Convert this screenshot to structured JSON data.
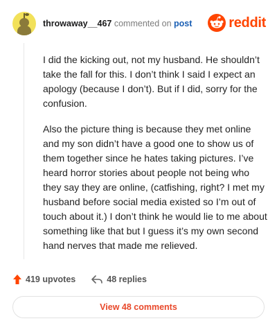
{
  "header": {
    "username": "throwaway__467",
    "action": "commented on",
    "link": "post",
    "brand": "reddit"
  },
  "comment": {
    "paragraphs": [
      "I did the kicking out, not my husband. He shouldn’t take the fall for this. I don’t think I said I expect an apology (because I don’t). But if I did, sorry for the confusion.",
      "Also the picture thing is because they met online and my son didn’t have a good one to show us of them together since he hates taking pictures. I’ve heard horror stories about people not being who they say they are online, (catfishing, right? I met my husband before social media existed so I’m out of touch about it.) I don’t think he would lie to me about something like that but I guess it’s my own second hand nerves that made me relieved."
    ]
  },
  "footer": {
    "upvotes": "419 upvotes",
    "replies": "48 replies",
    "view_comments": "View 48 comments"
  },
  "colors": {
    "brand": "#ff4500",
    "link": "#1a5fb4",
    "view_button_text": "#e8482a",
    "avatar_bg": "#f2e15a"
  },
  "icons": {
    "avatar": "avatar-icon",
    "brand": "reddit-snoo-icon",
    "upvote": "upvote-arrow-icon",
    "reply": "reply-arrow-icon"
  }
}
